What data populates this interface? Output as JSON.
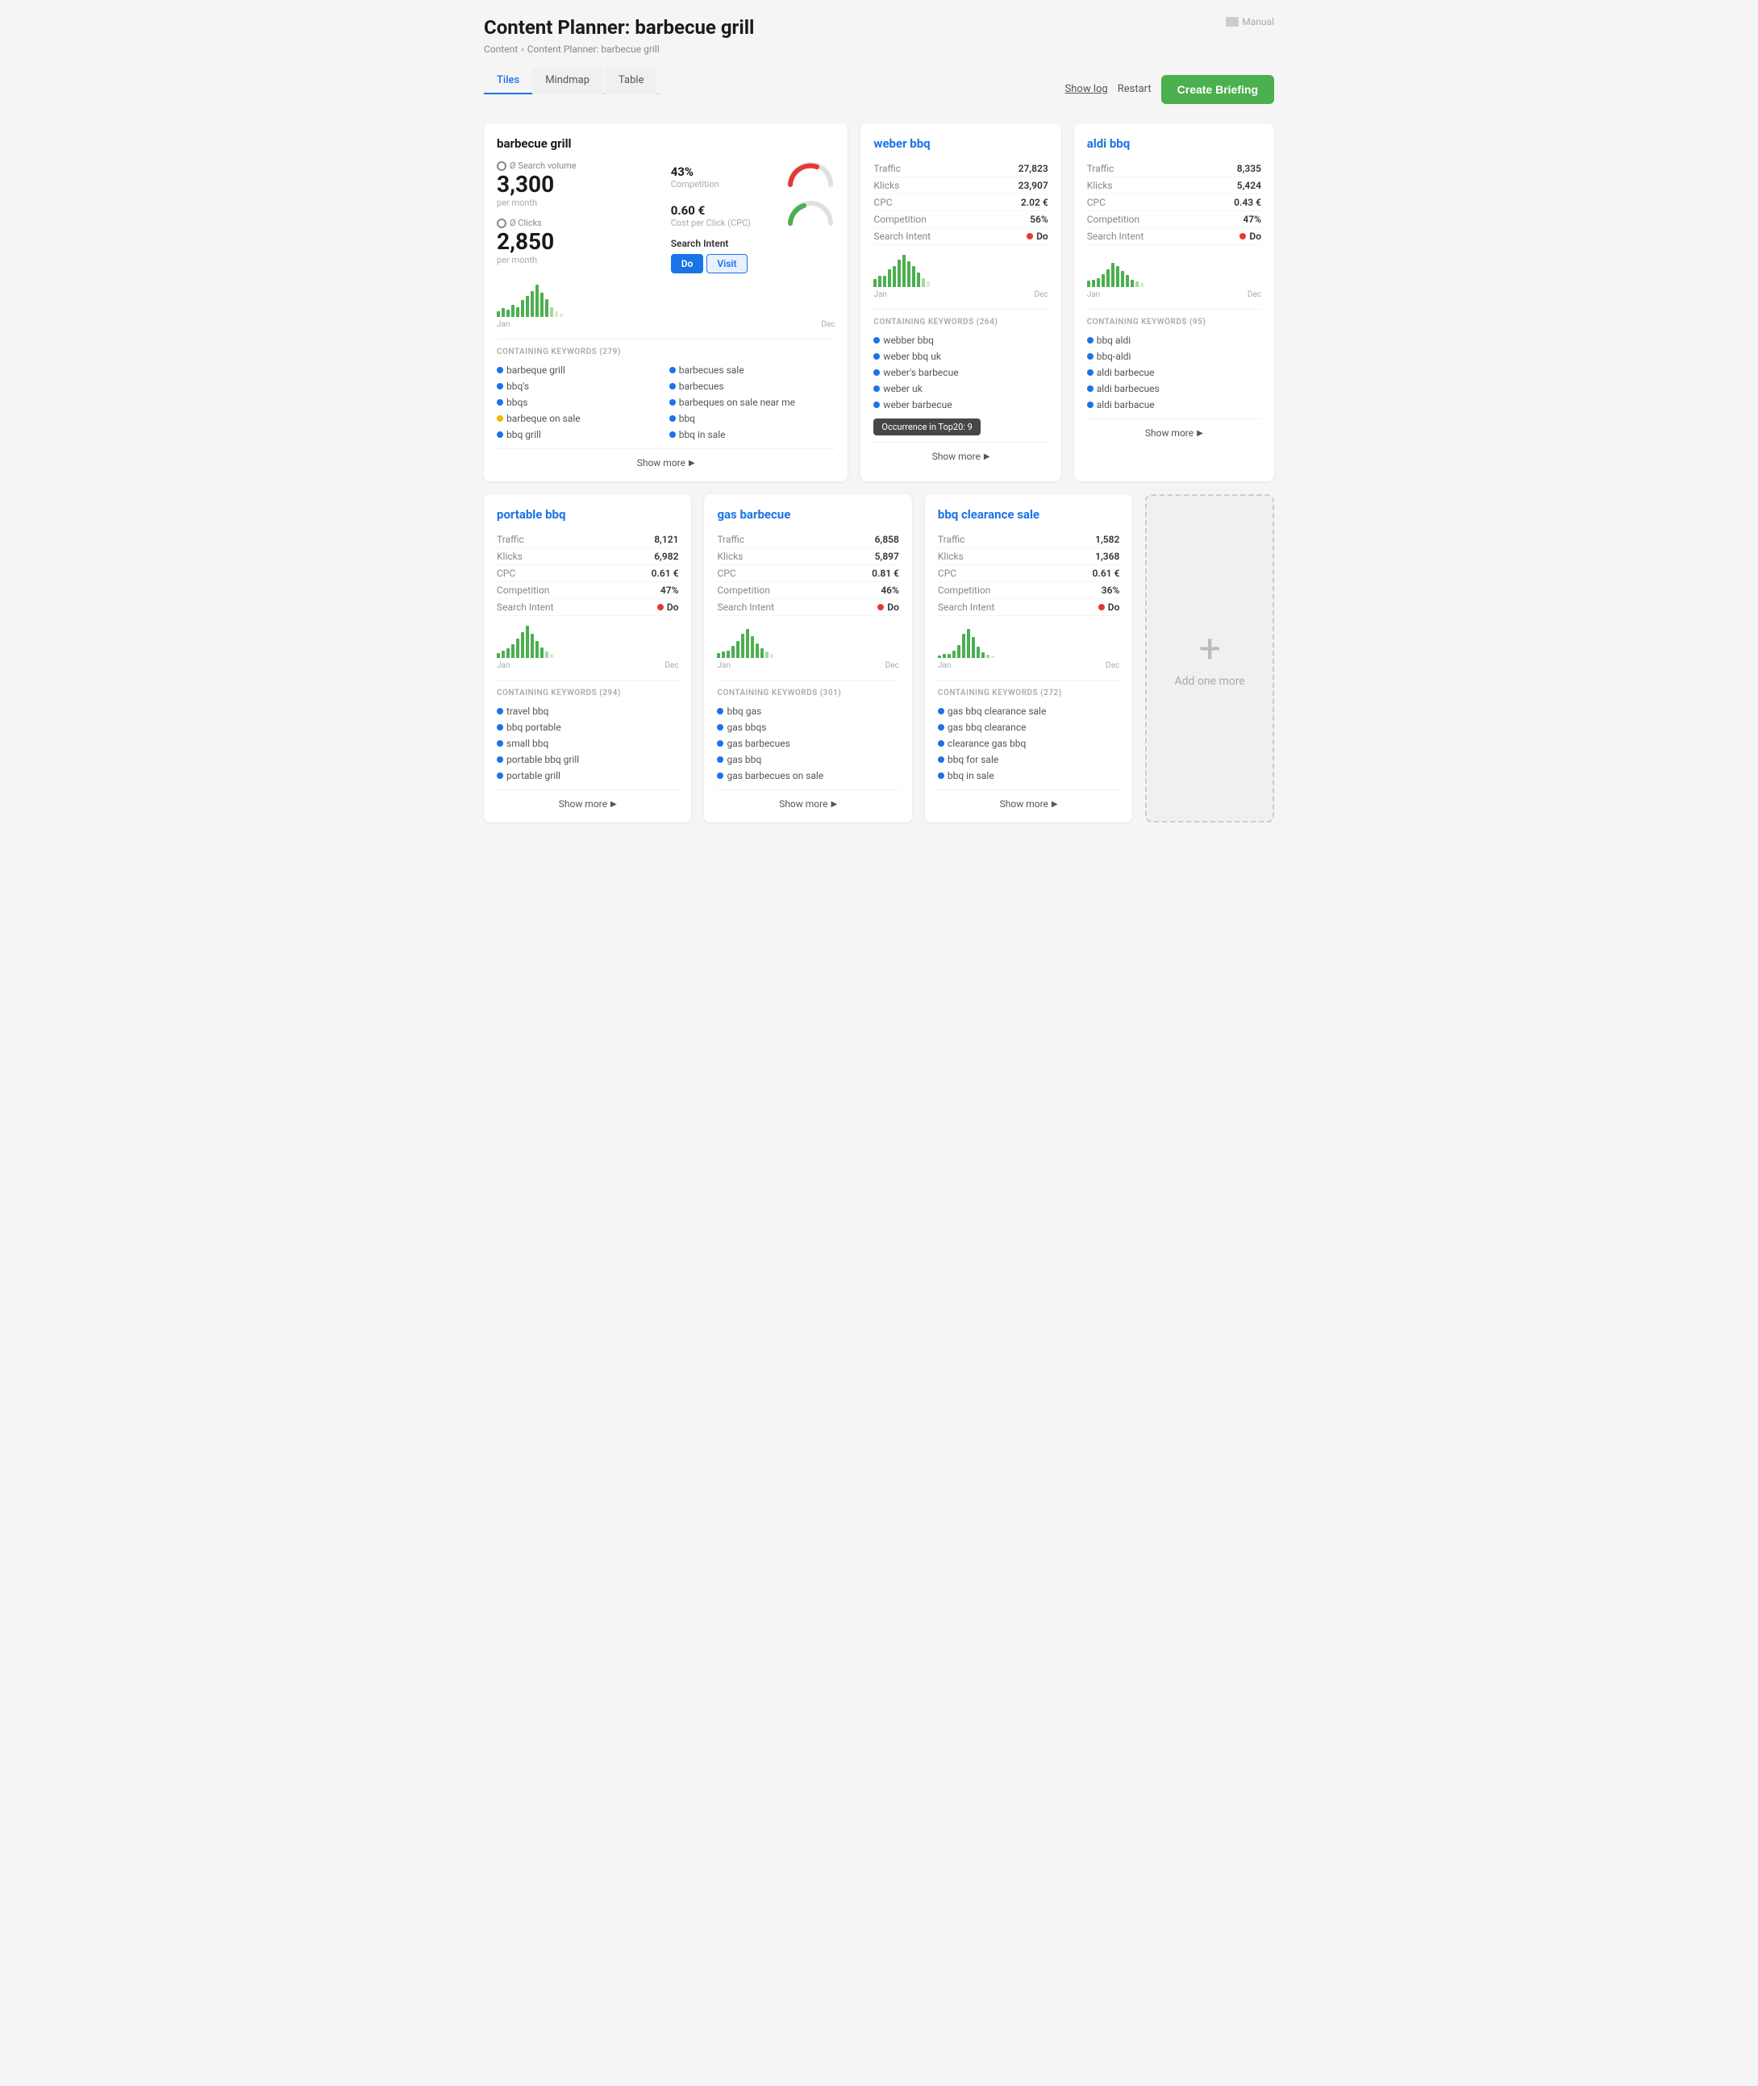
{
  "page": {
    "title": "Content Planner: barbecue grill",
    "breadcrumb": [
      "Content",
      "Content Planner: barbecue grill"
    ],
    "manual_label": "Manual"
  },
  "tabs": {
    "items": [
      {
        "label": "Tiles",
        "active": true
      },
      {
        "label": "Mindmap",
        "active": false
      },
      {
        "label": "Table",
        "active": false
      }
    ]
  },
  "header_actions": {
    "show_log": "Show log",
    "restart": "Restart",
    "create_briefing": "Create Briefing"
  },
  "tiles": {
    "main": {
      "title": "barbecue grill",
      "search_volume_label": "Ø Search volume",
      "per_month": "per month",
      "clicks_label": "Ø Clicks",
      "search_volume": "3,300",
      "clicks": "2,850",
      "competition_pct": "43%",
      "competition_label": "Competition",
      "cpc": "0.60 €",
      "cpc_label": "Cost per Click (CPC)",
      "search_intent_label": "Search Intent",
      "intent_do": "Do",
      "intent_visit": "Visit",
      "chart_bars": [
        3,
        5,
        4,
        6,
        5,
        7,
        8,
        9,
        10,
        8,
        6,
        4,
        3,
        2
      ],
      "chart_label_left": "Jan",
      "chart_label_right": "Dec",
      "keywords_header": "CONTAINING KEYWORDS (279)",
      "keywords": [
        {
          "text": "barbeque grill",
          "color": "#1a73e8"
        },
        {
          "text": "barbecues sale",
          "color": "#1a73e8"
        },
        {
          "text": "bbq's",
          "color": "#1a73e8"
        },
        {
          "text": "barbecues",
          "color": "#1a73e8"
        },
        {
          "text": "bbqs",
          "color": "#1a73e8"
        },
        {
          "text": "barbeques on sale near me",
          "color": "#1a73e8"
        },
        {
          "text": "barbeque on sale",
          "color": "#f4b400"
        },
        {
          "text": "bbq",
          "color": "#1a73e8"
        },
        {
          "text": "bbq grill",
          "color": "#1a73e8"
        },
        {
          "text": "bbq in sale",
          "color": "#1a73e8"
        }
      ],
      "show_more": "Show more"
    },
    "weber_bbq": {
      "title": "weber bbq",
      "traffic": "27,823",
      "klicks": "23,907",
      "cpc": "2.02 €",
      "competition": "56%",
      "search_intent": "Do",
      "chart_bars": [
        4,
        5,
        5,
        7,
        8,
        10,
        11,
        9,
        8,
        6,
        4,
        3
      ],
      "chart_label_left": "Jan",
      "chart_label_right": "Dec",
      "keywords_header": "CONTAINING KEYWORDS (264)",
      "keywords": [
        {
          "text": "webber bbq",
          "color": "#1a73e8"
        },
        {
          "text": "weber bbq uk",
          "color": "#1a73e8"
        },
        {
          "text": "weber's barbecue",
          "color": "#1a73e8"
        },
        {
          "text": "weber uk",
          "color": "#1a73e8"
        },
        {
          "text": "weber barbecue",
          "color": "#1a73e8"
        }
      ],
      "tooltip": "Occurrence in Top20: 9",
      "show_more": "Show more"
    },
    "aldi_bbq": {
      "title": "aldi bbq",
      "traffic": "8,335",
      "klicks": "5,424",
      "cpc": "0.43 €",
      "competition": "47%",
      "search_intent": "Do",
      "chart_bars": [
        3,
        3,
        4,
        5,
        6,
        7,
        6,
        5,
        4,
        3,
        3,
        2
      ],
      "chart_label_left": "Jan",
      "chart_label_right": "Dec",
      "keywords_header": "CONTAINING KEYWORDS (95)",
      "keywords": [
        {
          "text": "bbq aldi",
          "color": "#1a73e8"
        },
        {
          "text": "bbq-aldi",
          "color": "#1a73e8"
        },
        {
          "text": "aldi barbecue",
          "color": "#1a73e8"
        },
        {
          "text": "aldi barbecues",
          "color": "#1a73e8"
        },
        {
          "text": "aldi barbacue",
          "color": "#1a73e8"
        }
      ],
      "show_more": "Show more"
    },
    "portable_bbq": {
      "title": "portable bbq",
      "traffic": "8,121",
      "klicks": "6,982",
      "cpc": "0.61 €",
      "competition": "47%",
      "search_intent": "Do",
      "chart_bars": [
        2,
        3,
        4,
        5,
        7,
        9,
        10,
        8,
        6,
        4,
        3,
        2
      ],
      "chart_label_left": "Jan",
      "chart_label_right": "Dec",
      "keywords_header": "CONTAINING KEYWORDS (294)",
      "keywords": [
        {
          "text": "travel bbq",
          "color": "#1a73e8"
        },
        {
          "text": "bbq portable",
          "color": "#1a73e8"
        },
        {
          "text": "small bbq",
          "color": "#1a73e8"
        },
        {
          "text": "portable bbq grill",
          "color": "#1a73e8"
        },
        {
          "text": "portable grill",
          "color": "#1a73e8"
        }
      ],
      "show_more": "Show more"
    },
    "gas_barbecue": {
      "title": "gas barbecue",
      "traffic": "6,858",
      "klicks": "5,897",
      "cpc": "0.81 €",
      "competition": "46%",
      "search_intent": "Do",
      "chart_bars": [
        2,
        3,
        3,
        5,
        6,
        8,
        9,
        7,
        5,
        4,
        3,
        2
      ],
      "chart_label_left": "Jan",
      "chart_label_right": "Dec",
      "keywords_header": "CONTAINING KEYWORDS (301)",
      "keywords": [
        {
          "text": "bbq gas",
          "color": "#1a73e8"
        },
        {
          "text": "gas bbqs",
          "color": "#1a73e8"
        },
        {
          "text": "gas barbecues",
          "color": "#1a73e8"
        },
        {
          "text": "gas bbq",
          "color": "#1a73e8"
        },
        {
          "text": "gas barbecues on sale",
          "color": "#1a73e8"
        }
      ],
      "show_more": "Show more"
    },
    "bbq_clearance_sale": {
      "title": "bbq clearance sale",
      "traffic": "1,582",
      "klicks": "1,368",
      "cpc": "0.61 €",
      "competition": "36%",
      "search_intent": "Do",
      "chart_bars": [
        1,
        2,
        2,
        3,
        5,
        8,
        9,
        7,
        4,
        2,
        1,
        1
      ],
      "chart_label_left": "Jan",
      "chart_label_right": "Dec",
      "keywords_header": "CONTAINING KEYWORDS (272)",
      "keywords": [
        {
          "text": "gas bbq clearance sale",
          "color": "#1a73e8"
        },
        {
          "text": "gas bbq clearance",
          "color": "#1a73e8"
        },
        {
          "text": "clearance gas bbq",
          "color": "#1a73e8"
        },
        {
          "text": "bbq for sale",
          "color": "#1a73e8"
        },
        {
          "text": "bbq in sale",
          "color": "#1a73e8"
        }
      ],
      "show_more": "Show more"
    },
    "add_one_more": {
      "label": "Add one more"
    }
  },
  "colors": {
    "green": "#4caf50",
    "blue": "#1a73e8",
    "red": "#e53935",
    "brand_green": "#4caf50"
  }
}
